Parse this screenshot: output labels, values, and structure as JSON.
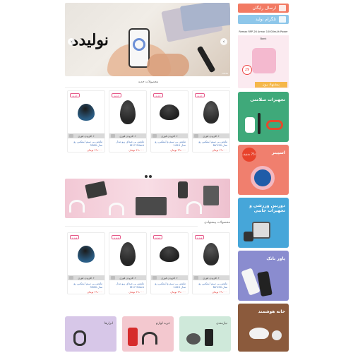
{
  "hero": {
    "title": "نولیده",
    "prev_icon": "chevron-left-icon",
    "next_icon": "chevron-right-icon",
    "corner_text": "nolide"
  },
  "sidebar": {
    "free_shipping": "ارسال رایگان",
    "free_shipping_icon": "truck-icon",
    "telegram": "تلگرام نولید",
    "telegram_icon": "telegram-icon",
    "promo_caption": "Remax RPP-26 Armor 10000mAh Power Bank",
    "promo_discount": "29",
    "promo_tag": "پیشنهاد روز",
    "categories": [
      {
        "label": "تجهیزات سلامتی",
        "color": "#3fa97a"
      },
      {
        "label": "اسپینر",
        "color": "#f07f6e"
      },
      {
        "label": "دوربین ورزشی و تجهیزات جانبی",
        "color": "#46a6d9"
      },
      {
        "label": "پاور بانک",
        "color": "#8a8ccf"
      },
      {
        "label": "خانه هوشمند",
        "color": "#8b5a3c"
      }
    ],
    "spinner_offer": "75٪ تخفیف"
  },
  "sections": {
    "new_products": "محصولات جدید",
    "suggested_products": "محصولات پیشنهادی"
  },
  "products_new": [
    {
      "name": "ماوس بی سیم اینتکس رو مدل NY130",
      "price": "۲۹،۰۰۰ تومان",
      "badge": "جدید",
      "add": "افزودن فوری"
    },
    {
      "name": "ماوس بی سیم و اینتکس رو مدل 1420",
      "price": "۳۹،۰۰۰ تومان",
      "badge": "جدید",
      "add": "افزودن فوری"
    },
    {
      "name": "ماوس بی صدای رپو مدل M17 Silent",
      "price": "۴۹،۰۰۰ تومان",
      "badge": "جدید",
      "add": "افزودن فوری"
    },
    {
      "name": "ماوس بی سیم اینتکس رو مدل 3360",
      "price": "۴۹،۰۰۰ تومان",
      "badge": "جدید",
      "add": "افزودن فوری"
    }
  ],
  "products_suggested": [
    {
      "name": "ماوس بی سیم اینتکس رو مدل NY130",
      "price": "۲۹،۰۰۰ تومان",
      "badge": "ویژه",
      "add": "افزودن فوری"
    },
    {
      "name": "ماوس بی سیم و اینتکس رو مدل 1420",
      "price": "۳۹،۰۰۰ تومان",
      "badge": "ویژه",
      "add": "افزودن فوری"
    },
    {
      "name": "ماوس بی صدای رپو مدل M17 Silent",
      "price": "۴۹،۰۰۰ تومان",
      "badge": "ویژه",
      "add": "افزودن فوری"
    },
    {
      "name": "ماوس بی سیم اینتکس رو مدل 3360",
      "price": "۴۹،۰۰۰ تومان",
      "badge": "ویژه",
      "add": "افزودن فوری"
    }
  ],
  "bottom_categories": [
    {
      "label": "ابزارها",
      "color": "#d7c7e8"
    },
    {
      "label": "خرید لوازم",
      "color": "#f3c8cf"
    },
    {
      "label": "نیازمندی",
      "color": "#cfe9da"
    }
  ]
}
